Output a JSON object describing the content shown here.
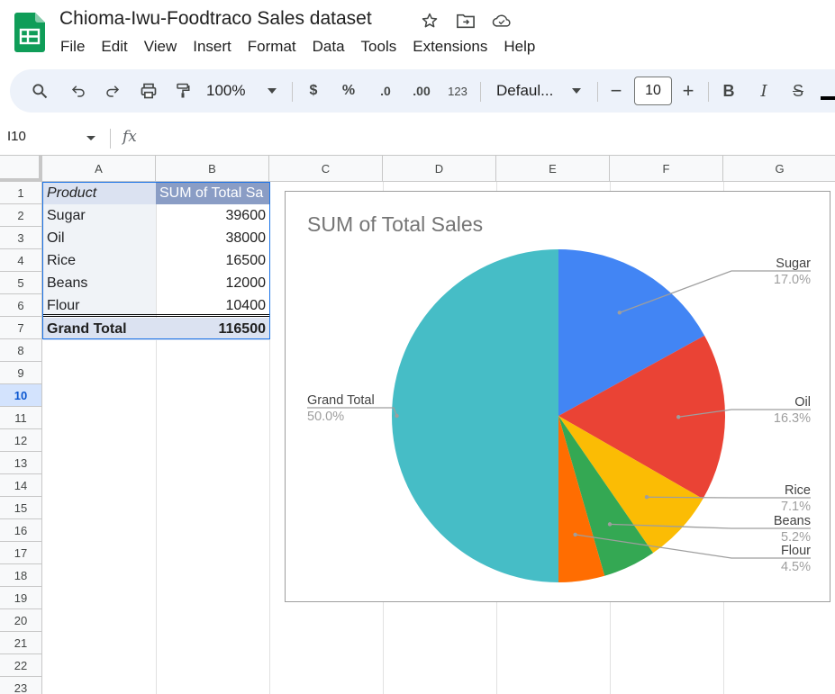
{
  "app": {
    "title": "Chioma-Iwu-Foodtraco Sales dataset",
    "menu": [
      "File",
      "Edit",
      "View",
      "Insert",
      "Format",
      "Data",
      "Tools",
      "Extensions",
      "Help"
    ],
    "brand_color": "#0f9d58"
  },
  "toolbar": {
    "zoom": "100%",
    "currency": "$",
    "percent": "%",
    "decrease_decimal": ".0",
    "increase_decimal": ".00",
    "number_format": "123",
    "font": "Defaul...",
    "font_size": "10",
    "minus": "−",
    "plus": "+",
    "bold": "B",
    "italic": "I",
    "strikethrough": "S"
  },
  "formula_bar": {
    "cell_ref": "I10",
    "fx": "fx",
    "value": ""
  },
  "grid": {
    "columns": [
      "A",
      "B",
      "C",
      "D",
      "E",
      "F",
      "G"
    ],
    "rows": [
      "1",
      "2",
      "3",
      "4",
      "5",
      "6",
      "7",
      "8",
      "9",
      "10",
      "11",
      "12",
      "13",
      "14",
      "15",
      "16",
      "17",
      "18",
      "19",
      "20",
      "21",
      "22",
      "23"
    ],
    "selected_row": "10"
  },
  "pivot": {
    "header_product": "Product",
    "header_value": "SUM of Total Sa",
    "rows": [
      {
        "product": "Sugar",
        "value": "39600"
      },
      {
        "product": "Oil",
        "value": "38000"
      },
      {
        "product": "Rice",
        "value": "16500"
      },
      {
        "product": "Beans",
        "value": "12000"
      },
      {
        "product": "Flour",
        "value": "10400"
      }
    ],
    "total_label": "Grand Total",
    "total_value": "116500"
  },
  "chart_data": {
    "type": "pie",
    "title": "SUM of Total Sales",
    "legend": "labels outside slices",
    "slices": [
      {
        "label": "Sugar",
        "value": 39600,
        "percent": "17.0%",
        "color": "#4285f4"
      },
      {
        "label": "Oil",
        "value": 38000,
        "percent": "16.3%",
        "color": "#ea4335"
      },
      {
        "label": "Rice",
        "value": 16500,
        "percent": "7.1%",
        "color": "#fbbc04"
      },
      {
        "label": "Beans",
        "value": 12000,
        "percent": "5.2%",
        "color": "#34a853"
      },
      {
        "label": "Flour",
        "value": 10400,
        "percent": "4.5%",
        "color": "#ff6d01"
      },
      {
        "label": "Grand Total",
        "value": 116500,
        "percent": "50.0%",
        "color": "#46bdc6"
      }
    ]
  }
}
